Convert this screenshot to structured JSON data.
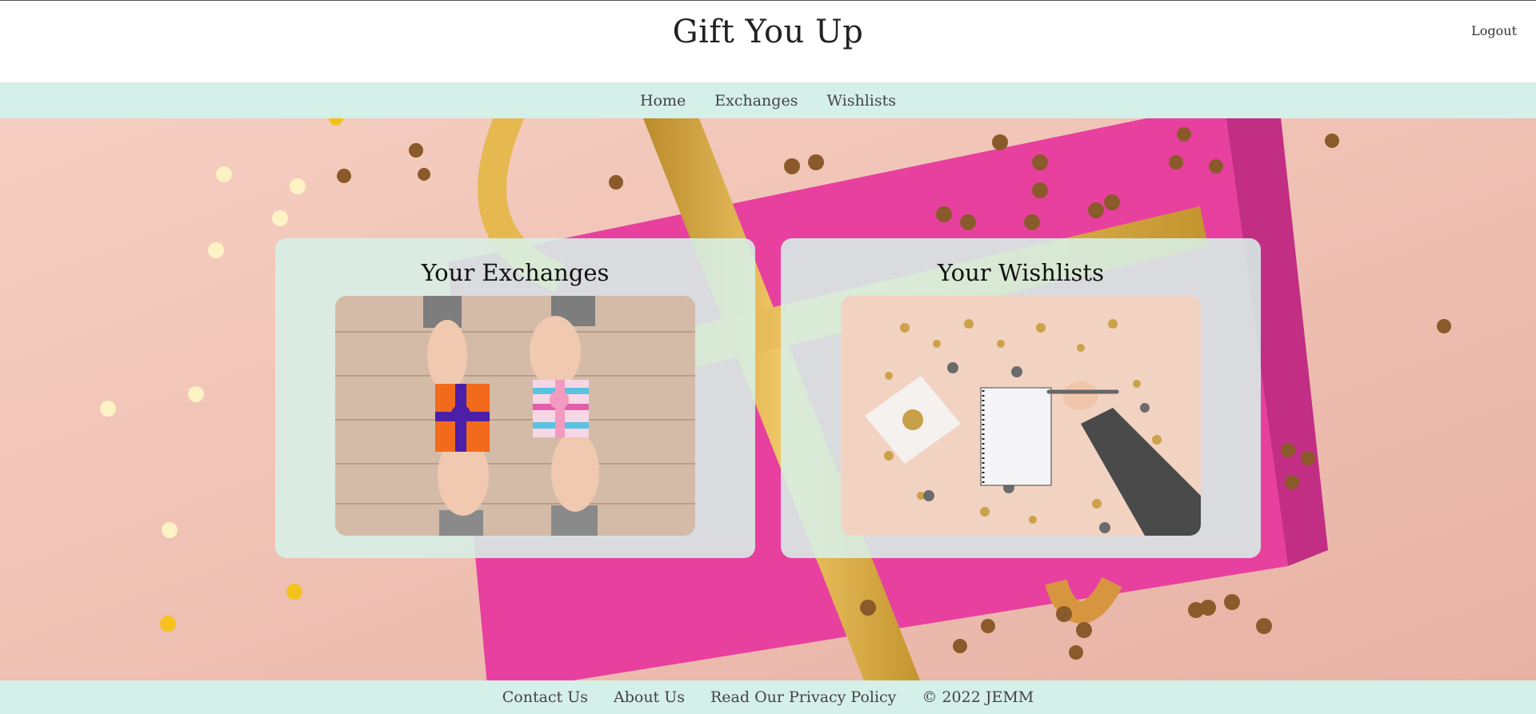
{
  "header": {
    "site_title": "Gift You Up",
    "logout_label": "Logout"
  },
  "nav": {
    "items": [
      {
        "label": "Home"
      },
      {
        "label": "Exchanges"
      },
      {
        "label": "Wishlists"
      }
    ]
  },
  "cards": {
    "exchanges": {
      "title": "Your Exchanges"
    },
    "wishlists": {
      "title": "Your Wishlists"
    }
  },
  "footer": {
    "contact_label": "Contact Us",
    "about_label": "About Us",
    "privacy_label": "Read Our Privacy Policy",
    "copyright": "© 2022 JEMM"
  },
  "colors": {
    "band_mint": "#d5efe9",
    "card_mint": "#d7f0e7",
    "hero_pink": "#f2c6b8",
    "gift_magenta": "#e8409f",
    "ribbon_gold": "#d8a73e"
  }
}
